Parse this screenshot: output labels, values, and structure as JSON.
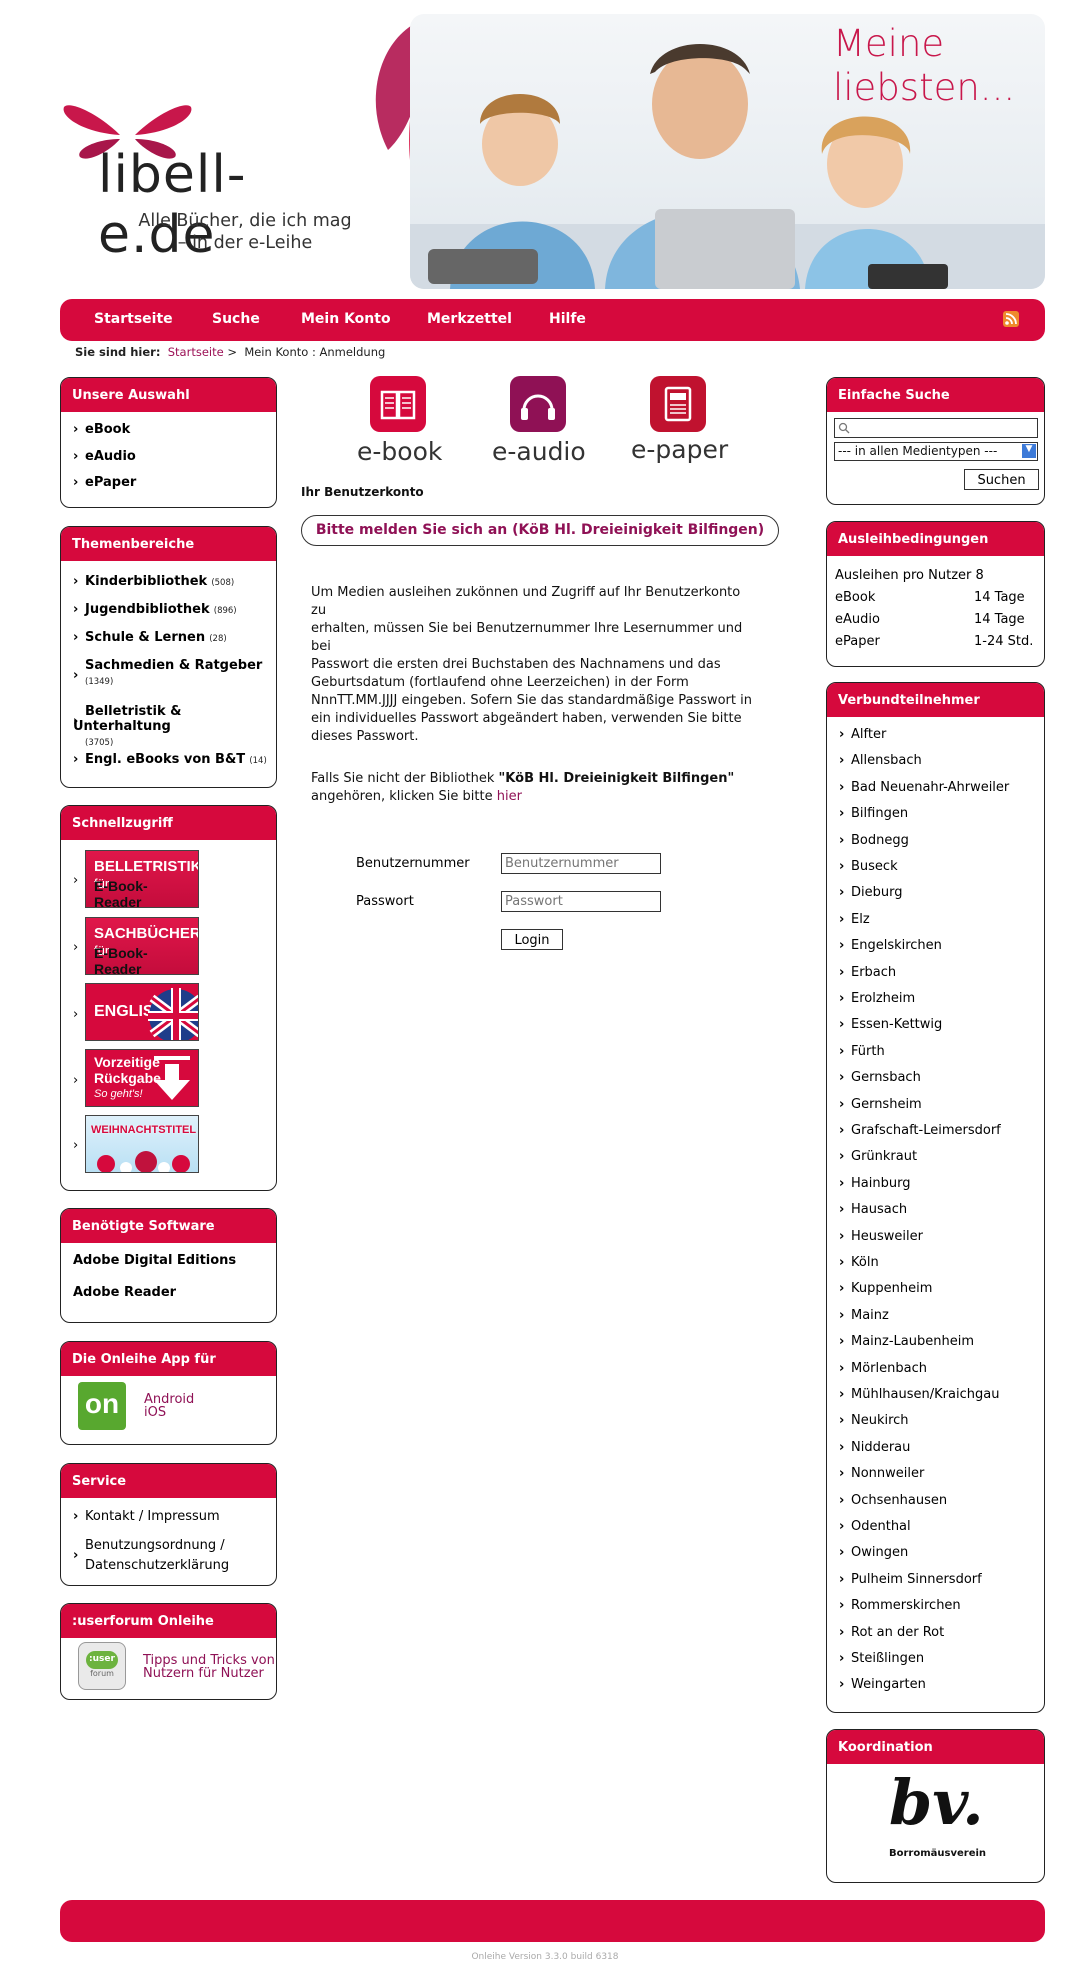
{
  "brand": {
    "logo_text": "libell-e.de",
    "tagline_1": "Alle Bücher, die ich mag",
    "tagline_2": "– in der e-Leihe",
    "banner_title": "Meine liebsten...",
    "accent": "#d6093d",
    "dark_accent": "#8f1155"
  },
  "nav": {
    "items": [
      "Startseite",
      "Suche",
      "Mein Konto",
      "Merkzettel",
      "Hilfe"
    ],
    "rss_icon": "rss-icon"
  },
  "breadcrumb": {
    "prefix": "Sie sind hier:",
    "home": "Startseite",
    "separator": ">",
    "current": "Mein Konto : Anmeldung"
  },
  "left": {
    "auswahl": {
      "title": "Unsere Auswahl",
      "items": [
        "eBook",
        "eAudio",
        "ePaper"
      ]
    },
    "themen": {
      "title": "Themenbereiche",
      "items": [
        {
          "label": "Kinderbibliothek",
          "count": "(508)"
        },
        {
          "label": "Jugendbibliothek",
          "count": "(896)"
        },
        {
          "label": "Schule & Lernen",
          "count": "(28)"
        },
        {
          "label": "Sachmedien & Ratgeber",
          "count": "(1349)"
        },
        {
          "label": "Belletristik & Unterhaltung",
          "count": "(3705)"
        },
        {
          "label": "Engl. eBooks von B&T",
          "count": "(14)"
        }
      ]
    },
    "schnell": {
      "title": "Schnellzugriff",
      "promos": [
        {
          "line1": "BELLETRISTIK",
          "small": "für",
          "line2": "E-Book- Reader"
        },
        {
          "line1": "SACHBÜCHER",
          "small": "für",
          "line2": "E-Book- Reader"
        },
        {
          "line1": "ENGLISH"
        },
        {
          "line1": "Vorzeitige",
          "line2": "Rückgabe",
          "small": "So geht's!"
        },
        {
          "line1": "WEIHNACHTSTITEL"
        }
      ]
    },
    "software": {
      "title": "Benötigte Software",
      "items": [
        "Adobe Digital Editions",
        "Adobe Reader"
      ]
    },
    "app": {
      "title": "Die Onleihe App für",
      "logo": "on",
      "links": [
        "Android",
        "iOS"
      ]
    },
    "service": {
      "title": "Service",
      "items": [
        "Kontakt / Impressum",
        "Benutzungsordnung /",
        "Datenschutzerklärung"
      ]
    },
    "forum": {
      "title": ":userforum Onleihe",
      "logo_top": ":user",
      "logo_bottom": "forum",
      "text_1": "Tipps und Tricks von",
      "text_2": "Nutzern für Nutzer"
    }
  },
  "main": {
    "media": [
      "e-book",
      "e-audio",
      "e-paper"
    ],
    "heading": "Ihr Benutzerkonto",
    "login_notice": "Bitte melden Sie sich an (KöB Hl. Dreieinigkeit Bilfingen)",
    "info_lines": [
      "Um Medien ausleihen zukönnen und Zugriff auf Ihr Benutzerkonto zu",
      "erhalten, müssen Sie bei Benutzernummer Ihre Lesernummer und bei",
      "Passwort die ersten drei Buchstaben des Nachnamens und das",
      "Geburtsdatum (fortlaufend ohne Leerzeichen) in der Form",
      "NnnTT.MM.JJJJ eingeben. Sofern Sie das standardmäßige Passwort in",
      "ein individuelles Passwort abgeändert haben, verwenden Sie bitte",
      "dieses Passwort."
    ],
    "other_library_prefix": "Falls Sie nicht der Bibliothek ",
    "other_library_name": "\"KöB Hl. Dreieinigkeit Bilfingen\"",
    "other_library_suffix": "angehören, klicken Sie bitte ",
    "other_library_link": "hier",
    "user_label": "Benutzernummer",
    "user_placeholder": "Benutzernummer",
    "pass_label": "Passwort",
    "pass_placeholder": "Passwort",
    "login_button": "Login"
  },
  "right": {
    "search": {
      "title": "Einfache Suche",
      "select_value": "--- in allen Medientypen ---",
      "button": "Suchen"
    },
    "ausleih": {
      "title": "Ausleihbedingungen",
      "intro": "Ausleihen pro Nutzer 8",
      "rows": [
        {
          "type": "eBook",
          "value": "14 Tage"
        },
        {
          "type": "eAudio",
          "value": "14 Tage"
        },
        {
          "type": "ePaper",
          "value": "1-24 Std."
        }
      ]
    },
    "verbund": {
      "title": "Verbundteilnehmer",
      "items": [
        "Alfter",
        "Allensbach",
        "Bad Neuenahr-Ahrweiler",
        "Bilfingen",
        "Bodnegg",
        "Buseck",
        "Dieburg",
        "Elz",
        "Engelskirchen",
        "Erbach",
        "Erolzheim",
        "Essen-Kettwig",
        "Fürth",
        "Gernsbach",
        "Gernsheim",
        "Grafschaft-Leimersdorf",
        "Grünkraut",
        "Hainburg",
        "Hausach",
        "Heusweiler",
        "Köln",
        "Kuppenheim",
        "Mainz",
        "Mainz-Laubenheim",
        "Mörlenbach",
        "Mühlhausen/Kraichgau",
        "Neukirch",
        "Nidderau",
        "Nonnweiler",
        "Ochsenhausen",
        "Odenthal",
        "Owingen",
        "Pulheim Sinnersdorf",
        "Rommerskirchen",
        "Rot an der Rot",
        "Steißlingen",
        "Weingarten"
      ]
    },
    "koordination": {
      "title": "Koordination",
      "logo_text": "bv.",
      "logo_caption": "Borromäusverein"
    }
  },
  "footer": {
    "version": "Onleihe Version 3.3.0 build 6318"
  }
}
